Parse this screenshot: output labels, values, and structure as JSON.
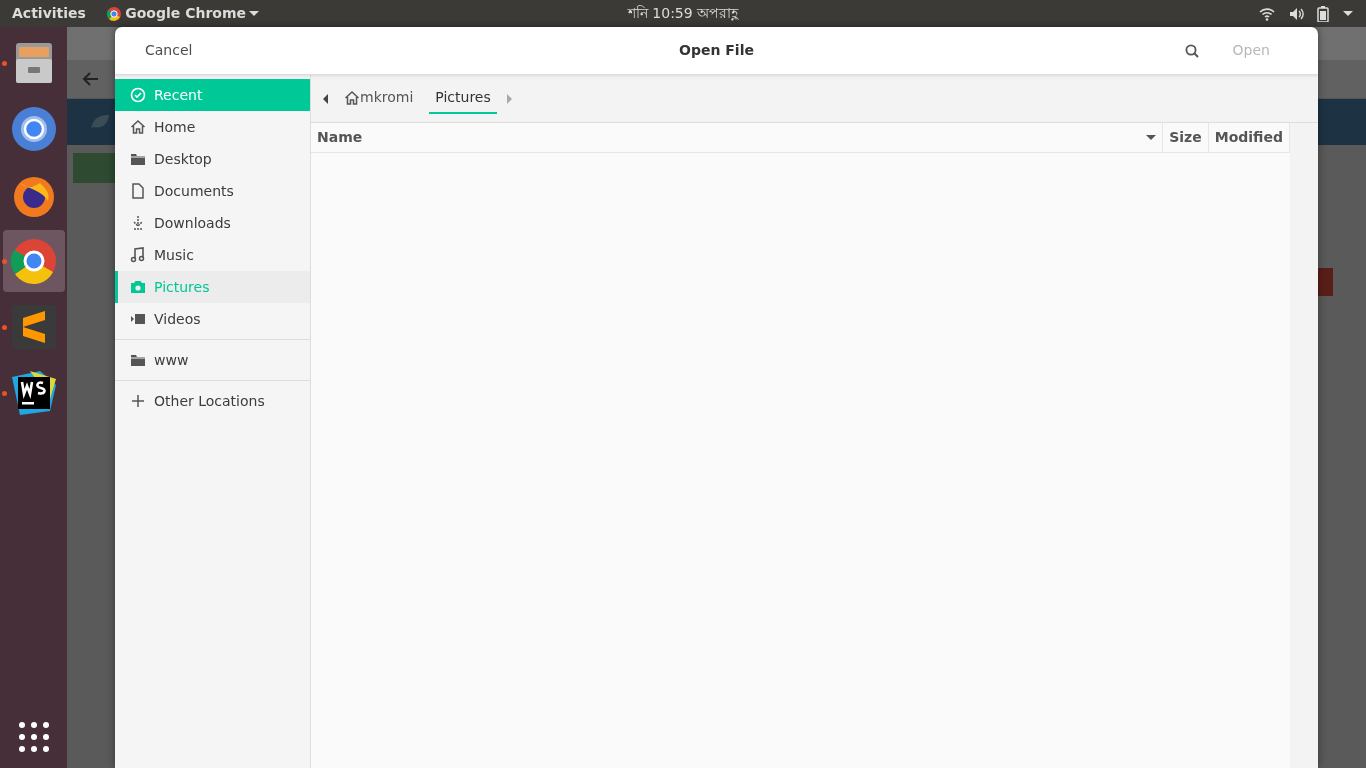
{
  "top_bar": {
    "activities": "Activities",
    "app_menu": "Google Chrome",
    "clock": "শনি 10:59 অপরাহ্ণ"
  },
  "dock": [
    {
      "kind": "files",
      "running": true,
      "selected": false
    },
    {
      "kind": "chromium",
      "running": false,
      "selected": false
    },
    {
      "kind": "firefox",
      "running": false,
      "selected": false
    },
    {
      "kind": "chrome",
      "running": true,
      "selected": true
    },
    {
      "kind": "sublime",
      "running": true,
      "selected": false
    },
    {
      "kind": "webstorm",
      "running": true,
      "selected": false
    }
  ],
  "dialog": {
    "title": "Open File",
    "cancel": "Cancel",
    "open": {
      "label": "Open",
      "disabled": true
    },
    "sidebar": {
      "sections": [
        [
          {
            "kind": "recent",
            "label": "Recent",
            "selected": true,
            "current": false
          },
          {
            "kind": "home",
            "label": "Home",
            "selected": false,
            "current": false
          },
          {
            "kind": "folder",
            "label": "Desktop",
            "selected": false,
            "current": false
          },
          {
            "kind": "document",
            "label": "Documents",
            "selected": false,
            "current": false
          },
          {
            "kind": "download",
            "label": "Downloads",
            "selected": false,
            "current": false
          },
          {
            "kind": "music",
            "label": "Music",
            "selected": false,
            "current": false
          },
          {
            "kind": "camera",
            "label": "Pictures",
            "selected": false,
            "current": true
          },
          {
            "kind": "video",
            "label": "Videos",
            "selected": false,
            "current": false
          }
        ],
        [
          {
            "kind": "folder",
            "label": "www",
            "selected": false,
            "current": false
          }
        ],
        [
          {
            "kind": "add",
            "label": "Other Locations",
            "selected": false,
            "current": false
          }
        ]
      ]
    },
    "path": [
      {
        "kind": "home",
        "label": "mkromi",
        "selected": false
      },
      {
        "kind": "folder",
        "label": "Pictures",
        "selected": true
      }
    ],
    "columns": [
      {
        "label": "Name",
        "sorted": true
      },
      {
        "label": "Size",
        "sorted": false
      },
      {
        "label": "Modified",
        "sorted": false
      }
    ]
  }
}
